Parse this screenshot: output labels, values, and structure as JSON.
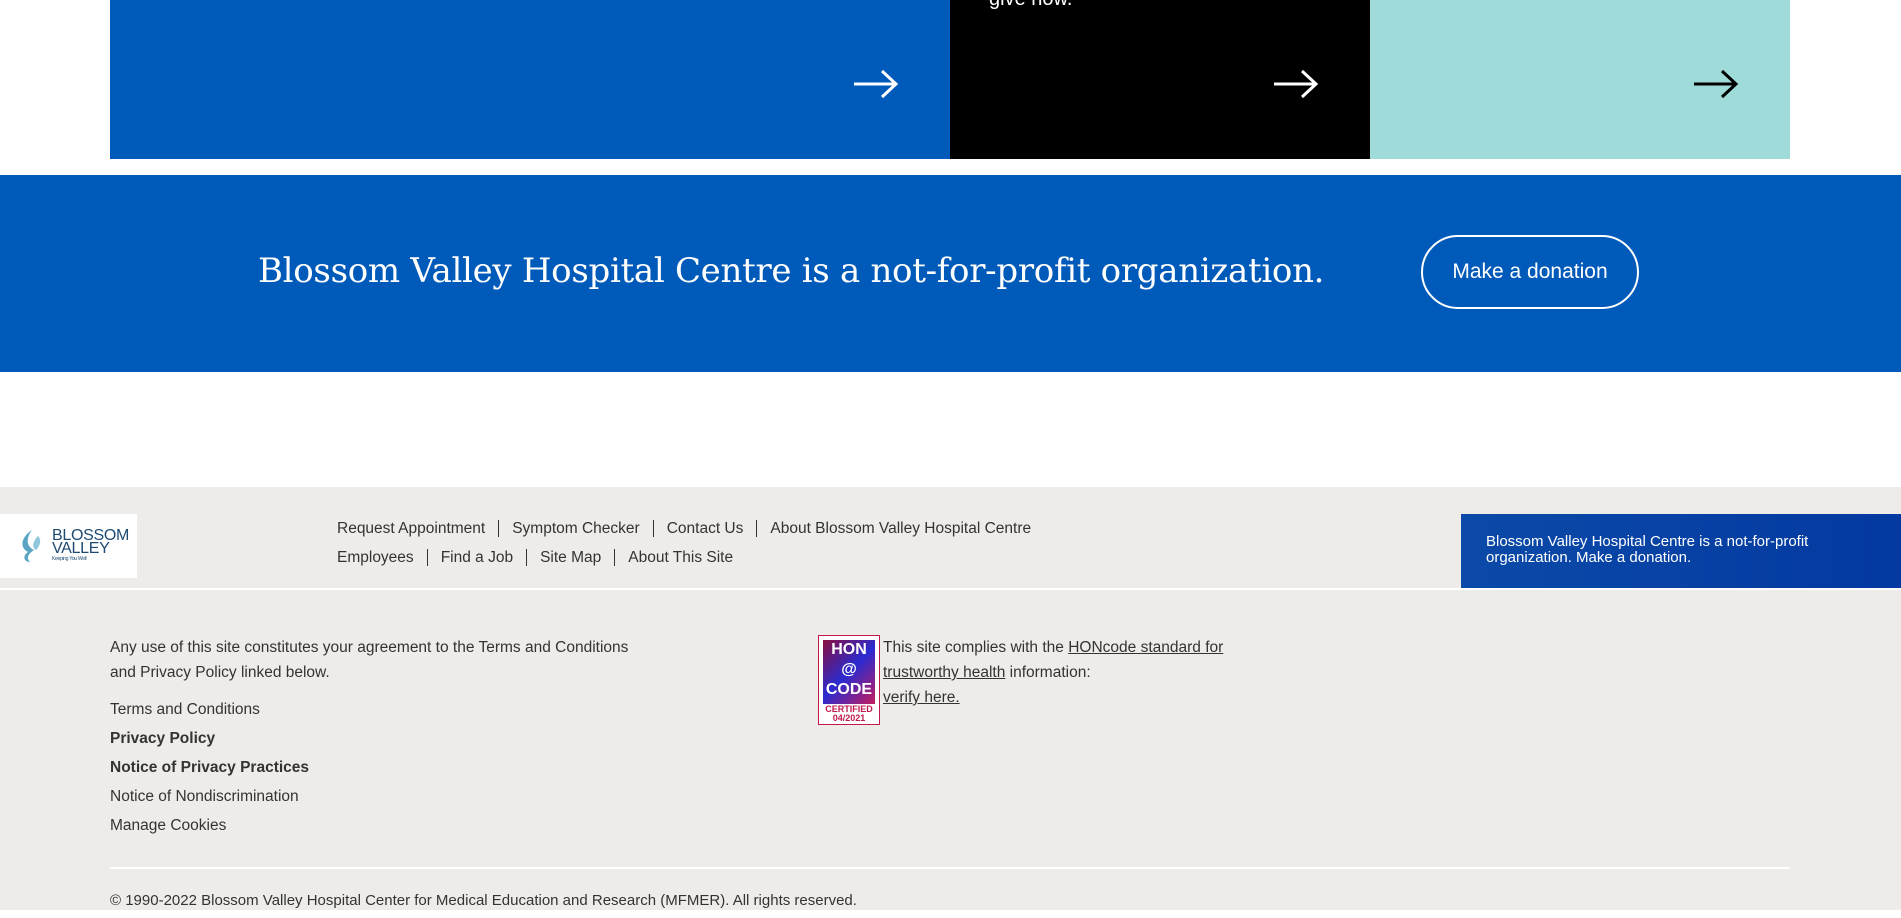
{
  "tiles": [
    {
      "text": "",
      "color": "#005ab9",
      "arrow_color": "#ffffff"
    },
    {
      "text": "give now.",
      "color": "#000000",
      "arrow_color": "#ffffff"
    },
    {
      "text": "",
      "color": "#9fdcd9",
      "arrow_color": "#000000"
    }
  ],
  "banner": {
    "text": "Blossom Valley Hospital Centre is a not-for-profit organization.",
    "button_label": "Make a donation",
    "color": "#005ab9"
  },
  "footer": {
    "logo": {
      "line1": "BLOSSOM",
      "line2": "VALLEY",
      "tagline": "Keeping You Well"
    },
    "nav_row1": [
      "Request Appointment",
      "Symptom Checker",
      "Contact Us",
      "About Blossom Valley Hospital Centre"
    ],
    "nav_row2": [
      "Employees",
      "Find a Job",
      "Site Map",
      "About This Site"
    ],
    "promo": "Blossom Valley Hospital Centre is a not-for-profit organization. Make a donation.",
    "agreement": "Any use of this site constitutes your agreement to the Terms and Conditions and Privacy Policy linked below.",
    "links": [
      {
        "label": "Terms and Conditions",
        "bold": false
      },
      {
        "label": "Privacy Policy",
        "bold": true
      },
      {
        "label": "Notice of Privacy Practices",
        "bold": true
      },
      {
        "label": "Notice of Nondiscrimination",
        "bold": false
      },
      {
        "label": "Manage Cookies",
        "bold": false
      }
    ],
    "hon": {
      "badge_line1": "HON",
      "badge_line2": "@",
      "badge_line3": "CODE",
      "certified": "CERTIFIED",
      "date": "04/2021",
      "text_before": "This site complies with the ",
      "link1": "HONcode standard for trustworthy health",
      "text_after": " information:",
      "link2": "verify here."
    },
    "copyright": "© 1990-2022 Blossom Valley Hospital Center for Medical Education and Research (MFMER). All rights reserved."
  }
}
